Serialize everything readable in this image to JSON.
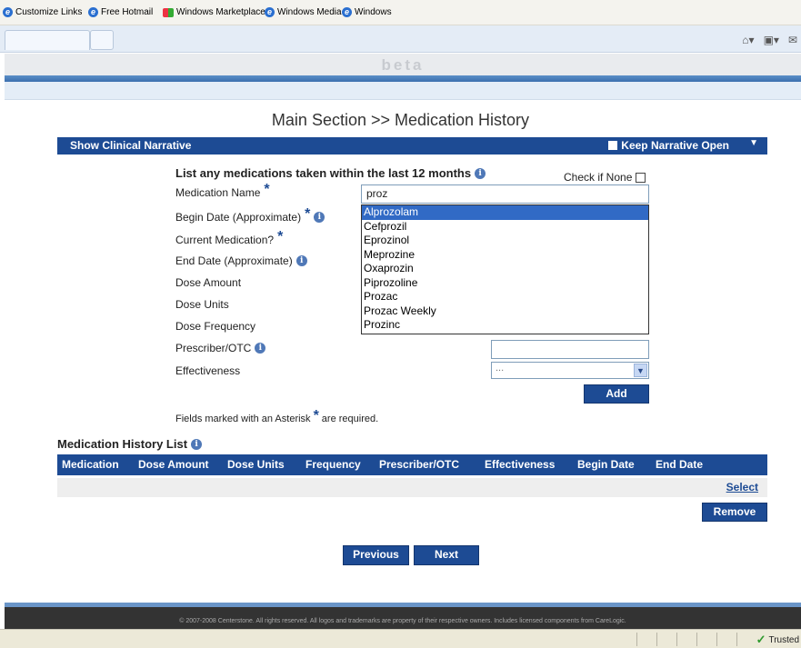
{
  "browser": {
    "links": [
      {
        "label": "Customize Links",
        "icon": "ie-icon"
      },
      {
        "label": "Free Hotmail",
        "icon": "ie-icon"
      },
      {
        "label": "Windows Marketplace",
        "icon": "windows-icon"
      },
      {
        "label": "Windows Media",
        "icon": "ie-icon"
      },
      {
        "label": "Windows",
        "icon": "ie-icon"
      }
    ],
    "status_zone": "Trusted"
  },
  "site": {
    "beta_label": "beta"
  },
  "page": {
    "title": "Main Section >> Medication History",
    "section_bar": {
      "left_label": "Show Clinical Narrative",
      "right_label": "Keep Narrative Open"
    }
  },
  "form": {
    "heading": "List any medications taken within the last 12 months",
    "check_none_label": "Check if None",
    "fields": {
      "medication_name": {
        "label": "Medication Name",
        "value": "proz"
      },
      "begin_date": {
        "label": "Begin Date (Approximate)"
      },
      "current_medication": {
        "label": "Current Medication?"
      },
      "end_date": {
        "label": "End Date (Approximate)"
      },
      "dose_amount": {
        "label": "Dose Amount"
      },
      "dose_units": {
        "label": "Dose Units"
      },
      "dose_frequency": {
        "label": "Dose Frequency"
      },
      "prescriber": {
        "label": "Prescriber/OTC"
      },
      "effectiveness": {
        "label": "Effectiveness",
        "value": "..."
      }
    },
    "autocomplete": [
      "Alprozolam",
      "Cefprozil",
      "Eprozinol",
      "Meprozine",
      "Oxaprozin",
      "Piprozoline",
      "Prozac",
      "Prozac Weekly",
      "Prozinc"
    ],
    "add_label": "Add",
    "required_note_prefix": "Fields marked with an Asterisk",
    "required_note_suffix": "are required."
  },
  "history": {
    "title": "Medication History List",
    "columns": [
      "Medication",
      "Dose Amount",
      "Dose Units",
      "Frequency",
      "Prescriber/OTC",
      "Effectiveness",
      "Begin Date",
      "End Date"
    ],
    "select_label": "Select",
    "remove_label": "Remove"
  },
  "nav": {
    "previous_label": "Previous",
    "next_label": "Next"
  },
  "footer": {
    "copyright": "© 2007-2008 Centerstone. All rights reserved. All logos and trademarks are property of their respective owners. Includes licensed components from CareLogic."
  },
  "colors": {
    "brand_blue": "#1d4b94",
    "highlight": "#316ac5"
  }
}
